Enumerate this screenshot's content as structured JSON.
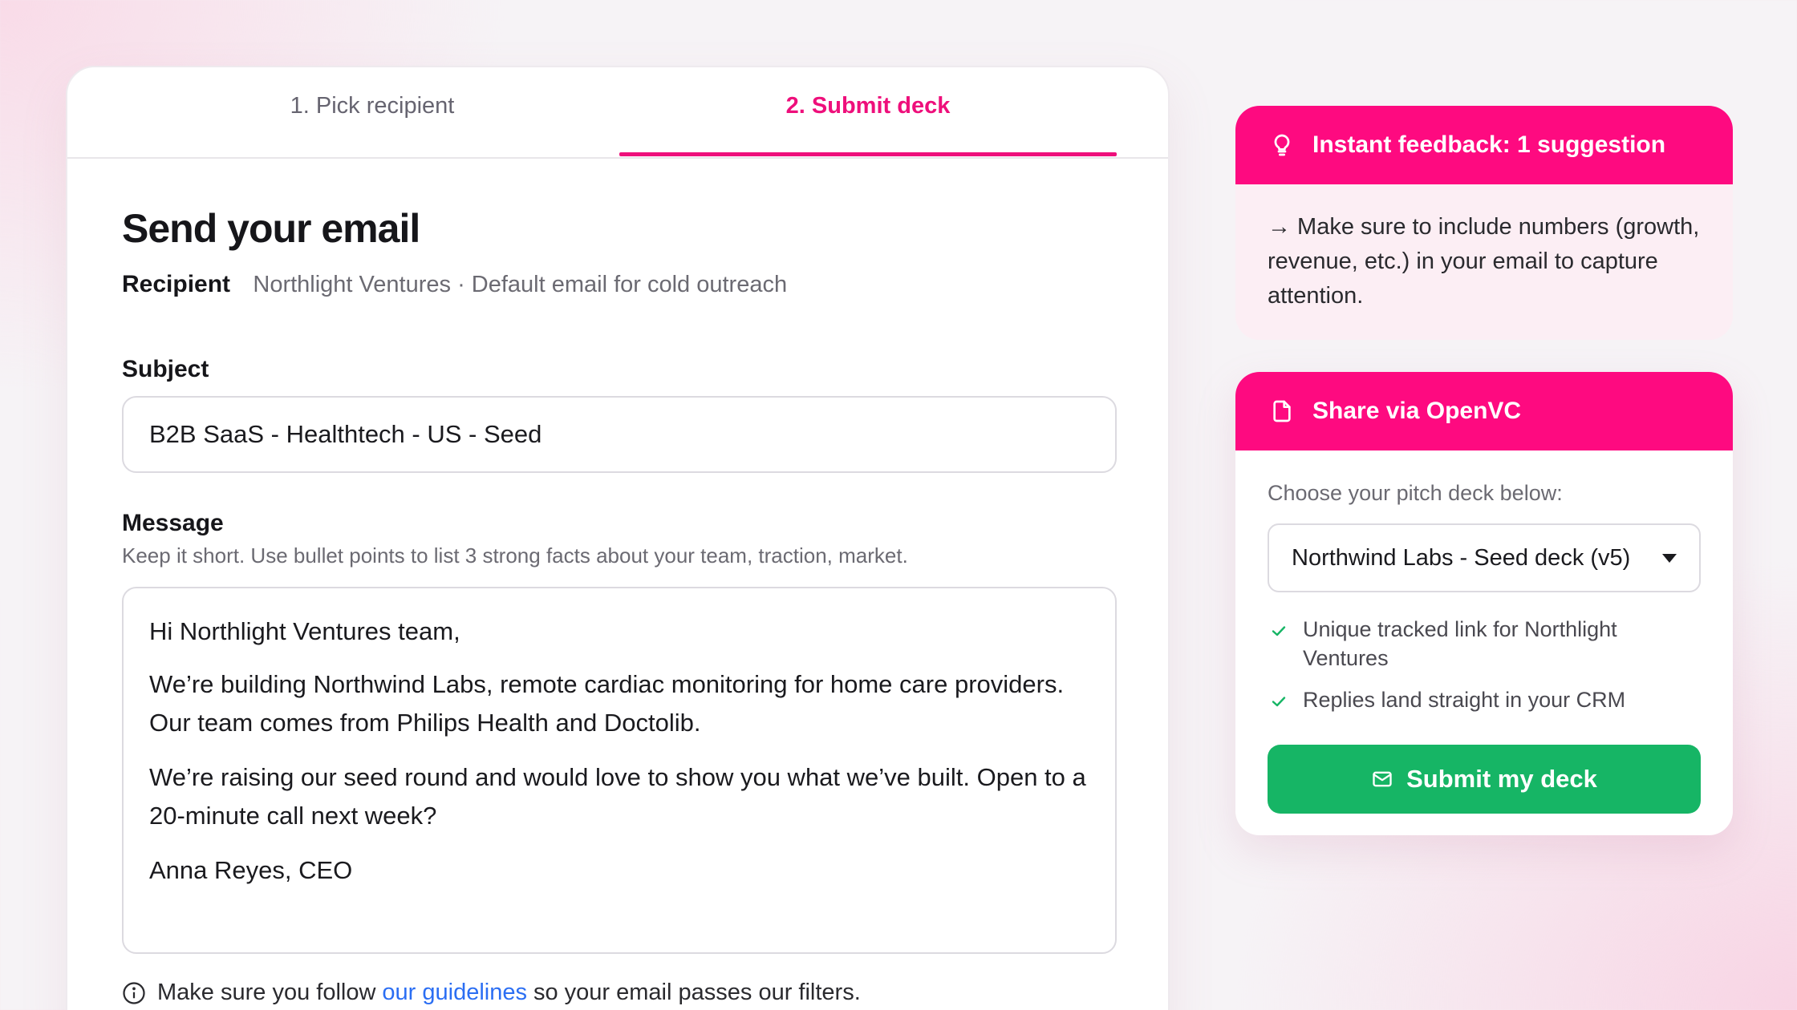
{
  "tabs": [
    {
      "label": "1. Pick recipient",
      "active": false
    },
    {
      "label": "2. Submit deck",
      "active": true
    }
  ],
  "form": {
    "title": "Send your email",
    "recipient_label": "Recipient",
    "recipient_value": "Northlight Ventures · Default email for cold outreach",
    "subject_label": "Subject",
    "subject_value": "B2B SaaS - Healthtech - US - Seed",
    "message_label": "Message",
    "message_hint": "Keep it short. Use bullet points to list 3 strong facts about your team, traction, market.",
    "message_paragraphs": [
      "Hi Northlight Ventures team,",
      "We’re building Northwind Labs, remote cardiac monitoring for home care providers. Our team comes from Philips Health and Doctolib.",
      "We’re raising our seed round and would love to show you what we’ve built. Open to a 20-minute call next week?",
      "Anna Reyes, CEO"
    ],
    "guideline_prefix": "Make sure you follow",
    "guideline_link": "our guidelines",
    "guideline_suffix": "so your email passes our filters."
  },
  "feedback": {
    "icon": "lightbulb-icon",
    "title": "Instant feedback: 1 suggestion",
    "text": "→ Make sure to include numbers (growth, revenue, etc.) in your email to capture attention."
  },
  "share": {
    "icon": "document-icon",
    "title": "Share via OpenVC",
    "choose_label": "Choose your pitch deck below:",
    "selected_deck": "Northwind Labs - Seed deck (v5)",
    "benefits": [
      "Unique tracked link for Northlight Ventures",
      "Replies land straight in your CRM"
    ],
    "submit_label": "Submit my deck"
  },
  "colors": {
    "accent": "#fe0a80",
    "tab_active": "#ee0f7b",
    "success": "#16b565",
    "link": "#2b6ef3"
  }
}
